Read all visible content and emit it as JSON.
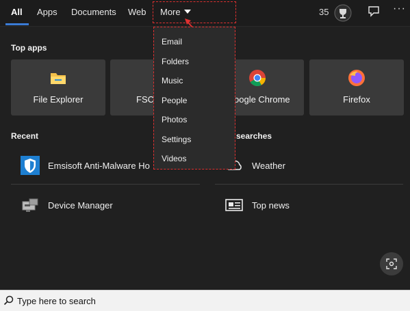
{
  "tabs": [
    {
      "label": "All"
    },
    {
      "label": "Apps"
    },
    {
      "label": "Documents"
    },
    {
      "label": "Web"
    },
    {
      "label": "More"
    }
  ],
  "header": {
    "points": "35"
  },
  "top_apps": {
    "title": "Top apps",
    "tiles": [
      {
        "label": "File Explorer"
      },
      {
        "label": "FSC"
      },
      {
        "label": "oogle Chrome"
      },
      {
        "label": "Firefox"
      }
    ]
  },
  "recent": {
    "title": "Recent",
    "items": [
      {
        "label": "Emsisoft Anti-Malware Ho"
      },
      {
        "label": "Device Manager"
      }
    ]
  },
  "top_searches": {
    "title": "searches",
    "items": [
      {
        "label": "Weather"
      },
      {
        "label": "Top news"
      }
    ]
  },
  "more_menu": {
    "items": [
      {
        "label": "Email"
      },
      {
        "label": "Folders"
      },
      {
        "label": "Music"
      },
      {
        "label": "People"
      },
      {
        "label": "Photos"
      },
      {
        "label": "Settings"
      },
      {
        "label": "Videos"
      }
    ]
  },
  "search": {
    "placeholder": "Type here to search"
  },
  "colors": {
    "accent": "#3a7bd5",
    "highlight": "#e03030",
    "background": "#202020"
  }
}
